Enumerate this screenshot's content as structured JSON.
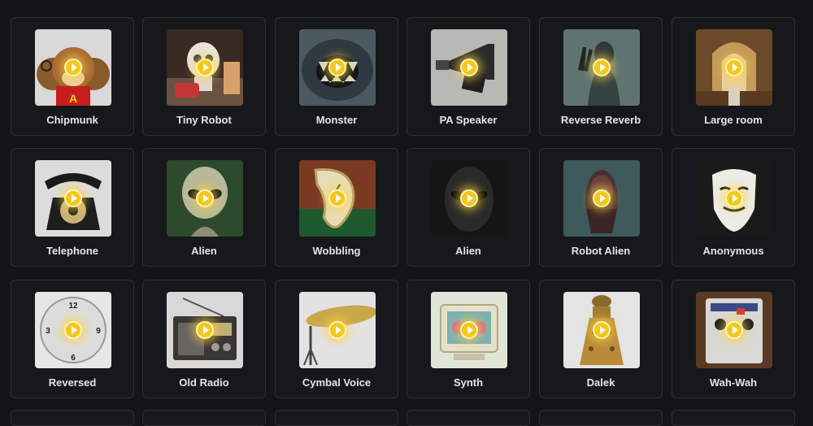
{
  "voices": [
    {
      "label": "Chipmunk",
      "icon": "chipmunk-image"
    },
    {
      "label": "Tiny Robot",
      "icon": "tiny-robot-image"
    },
    {
      "label": "Monster",
      "icon": "monster-image"
    },
    {
      "label": "PA Speaker",
      "icon": "pa-speaker-image"
    },
    {
      "label": "Reverse Reverb",
      "icon": "reverse-reverb-image"
    },
    {
      "label": "Large room",
      "icon": "large-room-image"
    },
    {
      "label": "Telephone",
      "icon": "telephone-image"
    },
    {
      "label": "Alien",
      "icon": "alien-image"
    },
    {
      "label": "Wobbling",
      "icon": "wobbling-clock-image"
    },
    {
      "label": "Alien",
      "icon": "alien-face-image"
    },
    {
      "label": "Robot Alien",
      "icon": "robot-alien-image"
    },
    {
      "label": "Anonymous",
      "icon": "anonymous-mask-image"
    },
    {
      "label": "Reversed",
      "icon": "reversed-clock-image"
    },
    {
      "label": "Old Radio",
      "icon": "old-radio-image"
    },
    {
      "label": "Cymbal Voice",
      "icon": "cymbal-image"
    },
    {
      "label": "Synth",
      "icon": "synth-monitor-image"
    },
    {
      "label": "Dalek",
      "icon": "dalek-image"
    },
    {
      "label": "Wah-Wah",
      "icon": "wah-pedal-image"
    }
  ],
  "accent": "#f2c81e"
}
